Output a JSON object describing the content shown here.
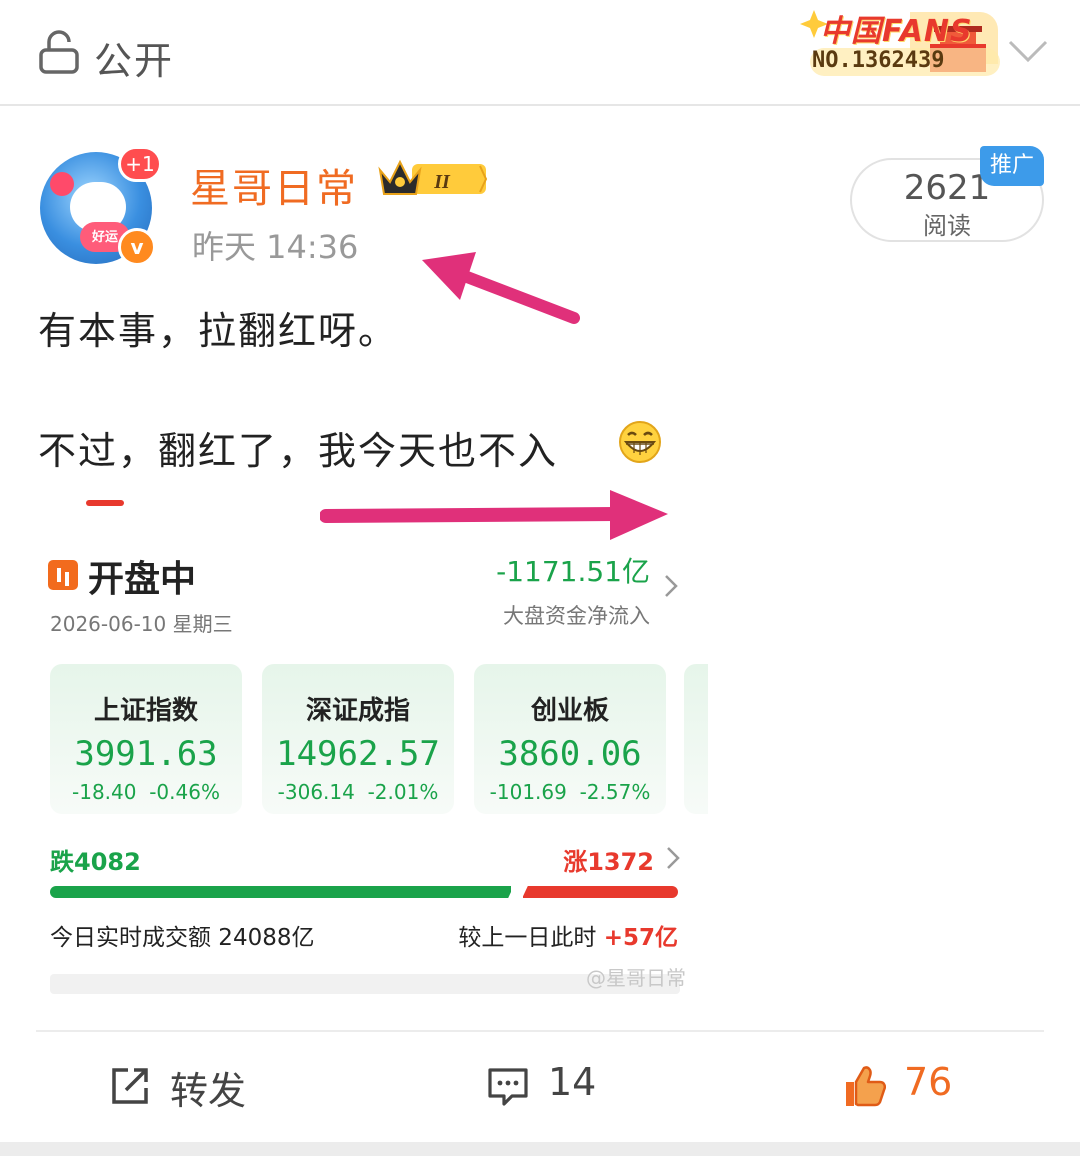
{
  "topbar": {
    "visibility_icon": "lock-icon",
    "visibility_label": "公开",
    "fans_badge": {
      "title": "中国FANS",
      "number": "NO.1362439"
    },
    "expand_icon": "chevron-down-icon"
  },
  "post": {
    "author": {
      "name": "星哥日常",
      "avatar_badge": "+1",
      "verified_mark": "v",
      "avatar_tag": "好运",
      "level_badge": "II"
    },
    "time": "昨天 14:36",
    "reads": {
      "count": "2621",
      "label": "阅读"
    },
    "promo_tag": "推广",
    "lines": [
      "有本事，拉翻红呀。",
      "不过，翻红了，我今天也不入"
    ],
    "emoji": "grin-icon",
    "accent_colors": {
      "author": "#f06b22",
      "rise": "#e8392d",
      "fall": "#1aa34a",
      "promo": "#3d9bea",
      "arrow": "#e0307a"
    }
  },
  "market": {
    "title": "开盘中",
    "date": "2026-06-10 星期三",
    "net_flow": "-1171.51亿",
    "net_flow_label": "大盘资金净流入",
    "indices": [
      {
        "name": "上证指数",
        "value": "3991.63",
        "change": "-18.40",
        "pct": "-0.46%"
      },
      {
        "name": "深证成指",
        "value": "14962.57",
        "change": "-306.14",
        "pct": "-2.01%"
      },
      {
        "name": "创业板",
        "value": "3860.06",
        "change": "-101.69",
        "pct": "-2.57%"
      }
    ],
    "fall_label": "跌4082",
    "rise_label": "涨1372",
    "fall_count": 4082,
    "rise_count": 1372,
    "volume_label": "今日实时成交额 24088亿",
    "compare_label": "较上一日此时",
    "compare_value": "+57亿",
    "watermark": "@星哥日常"
  },
  "actions": {
    "repost_label": "转发",
    "comment_count": "14",
    "like_count": "76"
  }
}
